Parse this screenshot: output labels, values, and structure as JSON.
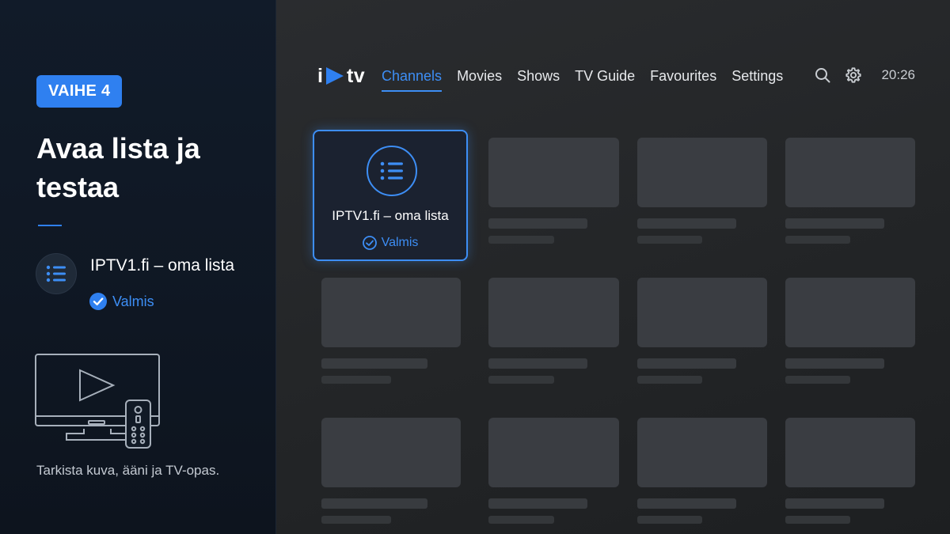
{
  "guide": {
    "step_badge": "VAIHE 4",
    "title": "Avaa lista ja testaa",
    "list_name": "IPTV1.fi – oma lista",
    "status": "Valmis",
    "footer": "Tarkista kuva, ääni ja TV-opas."
  },
  "app": {
    "logo_i": "i",
    "logo_tv": "tv",
    "nav": [
      {
        "label": "Channels",
        "active": true
      },
      {
        "label": "Movies",
        "active": false
      },
      {
        "label": "Shows",
        "active": false
      },
      {
        "label": "TV Guide",
        "active": false
      },
      {
        "label": "Favourites",
        "active": false
      },
      {
        "label": "Settings",
        "active": false
      }
    ],
    "clock": "20:26",
    "selected_card": {
      "title": "IPTV1.fi – oma lista",
      "status": "Valmis"
    }
  },
  "icons": [
    "list-icon",
    "check-circle-icon",
    "tv-remote-icon",
    "search-icon",
    "gear-icon",
    "play-logo-icon"
  ],
  "colors": {
    "accent": "#2f80f0",
    "panel": "#111b29",
    "app_bg": "#232527"
  }
}
